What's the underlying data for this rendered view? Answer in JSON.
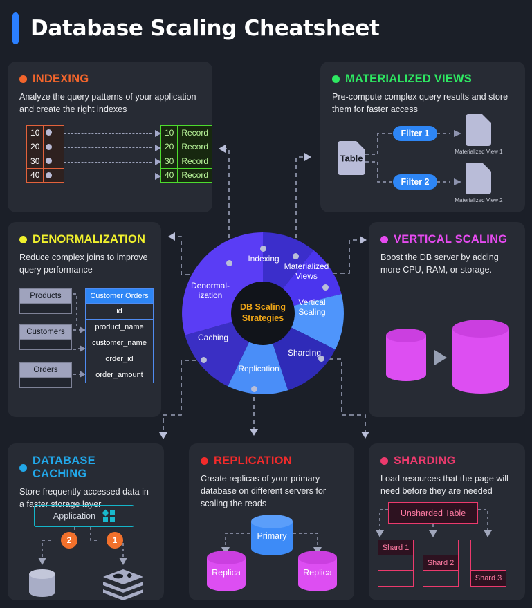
{
  "header": {
    "title": "Database Scaling Cheatsheet",
    "accent_color": "#2b7fff"
  },
  "wheel": {
    "hub_line1": "DB Scaling",
    "hub_line2": "Strategies",
    "hub_color": "#efa617",
    "segments": [
      {
        "label": "Indexing",
        "color": "#3b2ecb"
      },
      {
        "label": "Materialized\nViews",
        "color": "#4b35ee"
      },
      {
        "label": "Vertical\nScaling",
        "color": "#4f95fb"
      },
      {
        "label": "Sharding",
        "color": "#2f2bb8"
      },
      {
        "label": "Replication",
        "color": "#4a8ef8"
      },
      {
        "label": "Caching",
        "color": "#3a2fc4"
      },
      {
        "label": "Denormal-\nization",
        "color": "#5a3df5"
      }
    ]
  },
  "cards": {
    "indexing": {
      "title": "INDEXING",
      "dot_color": "#f2652c",
      "desc": "Analyze the query patterns of your application and create the right indexes",
      "index_keys": [
        "10",
        "20",
        "30",
        "40"
      ],
      "record_keys": [
        "10",
        "20",
        "30",
        "40"
      ],
      "record_label": "Record"
    },
    "materialized_views": {
      "title": "MATERIALIZED VIEWS",
      "dot_color": "#2ee862",
      "desc": "Pre-compute complex query results and store them for faster access",
      "source_label": "Table",
      "filters": [
        "Filter 1",
        "Filter 2"
      ],
      "view_captions": [
        "Materialized View 1",
        "Materialized View 2"
      ]
    },
    "denormalization": {
      "title": "DENORMALIZATION",
      "dot_color": "#f0f02d",
      "desc": "Reduce complex joins to improve query performance",
      "sources": [
        "Products",
        "Customers",
        "Orders"
      ],
      "target_title": "Customer Orders",
      "target_fields": [
        "id",
        "product_name",
        "customer_name",
        "order_id",
        "order_amount"
      ]
    },
    "vertical_scaling": {
      "title": "VERTICAL SCALING",
      "dot_color": "#e64bf0",
      "desc": "Boost the DB server by adding more CPU, RAM, or storage.",
      "small_label": "",
      "large_label": ""
    },
    "database_caching": {
      "title": "DATABASE CACHING",
      "dot_color": "#22a7e8",
      "desc": "Store frequently accessed data in a faster storage layer",
      "app_label": "Application",
      "step_badges": [
        "2",
        "1"
      ],
      "storage_icon": "database-cylinder-icon",
      "cache_icon": "cache-stack-icon"
    },
    "replication": {
      "title": "REPLICATION",
      "dot_color": "#f22b2b",
      "desc": "Create replicas of your primary database on different servers for scaling the reads",
      "primary_label": "Primary",
      "replica_labels": [
        "Replica",
        "Replica"
      ]
    },
    "sharding": {
      "title": "SHARDING",
      "dot_color": "#ec3a6d",
      "desc": "Load resources that the page will need before they are needed",
      "unsharded_label": "Unsharded Table",
      "shards": [
        "Shard 1",
        "Shard 2",
        "Shard 3"
      ]
    }
  }
}
